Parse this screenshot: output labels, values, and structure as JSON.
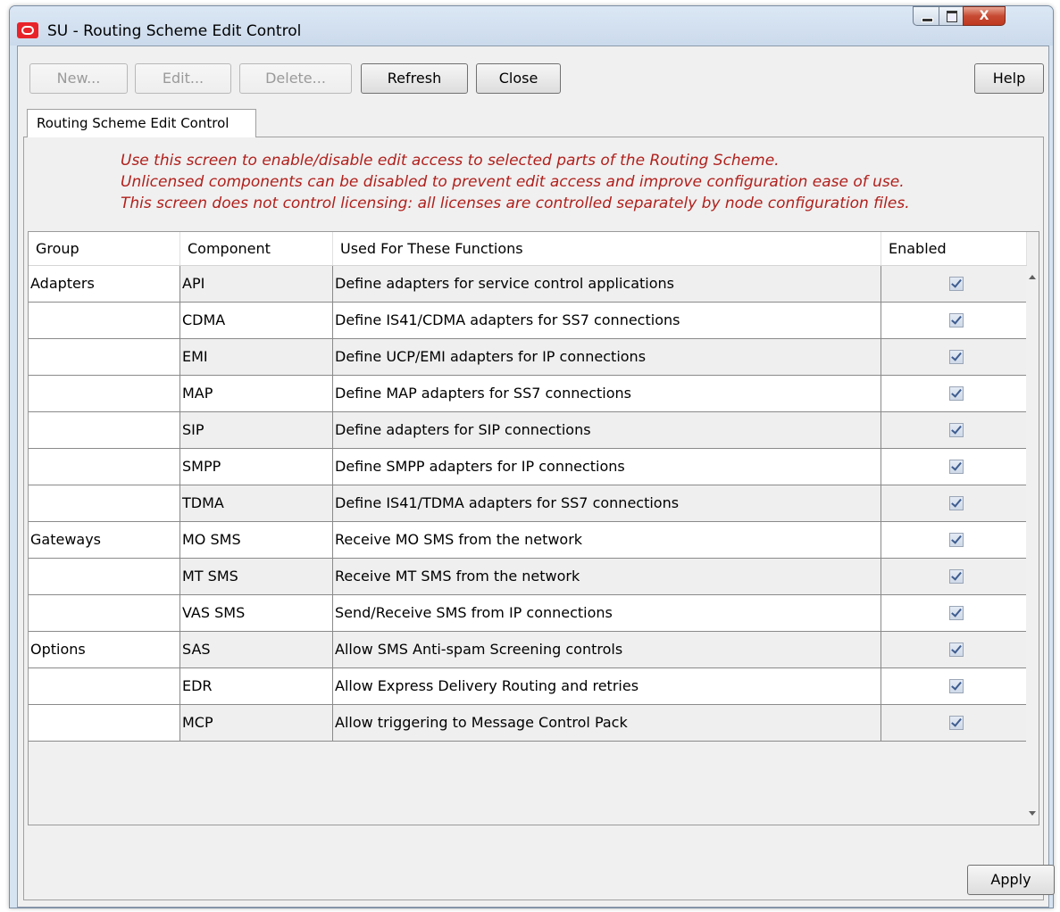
{
  "window": {
    "title": "SU - Routing Scheme Edit Control",
    "close_glyph": "X"
  },
  "toolbar": {
    "new_label": "New...",
    "edit_label": "Edit...",
    "delete_label": "Delete...",
    "refresh_label": "Refresh",
    "close_label": "Close",
    "help_label": "Help"
  },
  "tab": {
    "label": "Routing Scheme Edit Control"
  },
  "info_lines": [
    "Use this screen to enable/disable edit access to selected parts of the Routing Scheme.",
    "Unlicensed components can be disabled to prevent edit access and improve configuration ease of use.",
    "This screen does not control licensing: all licenses are controlled separately by node configuration files."
  ],
  "table": {
    "headers": [
      "Group",
      "Component",
      "Used For These Functions",
      "Enabled"
    ],
    "rows": [
      {
        "group": "Adapters",
        "component": "API",
        "function": "Define adapters for service control applications",
        "enabled": true
      },
      {
        "group": "",
        "component": "CDMA",
        "function": "Define IS41/CDMA adapters for SS7 connections",
        "enabled": true
      },
      {
        "group": "",
        "component": "EMI",
        "function": "Define UCP/EMI adapters for IP connections",
        "enabled": true
      },
      {
        "group": "",
        "component": "MAP",
        "function": "Define MAP adapters for SS7 connections",
        "enabled": true
      },
      {
        "group": "",
        "component": "SIP",
        "function": "Define adapters for SIP connections",
        "enabled": true
      },
      {
        "group": "",
        "component": "SMPP",
        "function": "Define SMPP adapters for IP connections",
        "enabled": true
      },
      {
        "group": "",
        "component": "TDMA",
        "function": "Define IS41/TDMA adapters for SS7 connections",
        "enabled": true
      },
      {
        "group": "Gateways",
        "component": "MO SMS",
        "function": "Receive MO SMS from the network",
        "enabled": true
      },
      {
        "group": "",
        "component": "MT SMS",
        "function": "Receive MT SMS from the network",
        "enabled": true
      },
      {
        "group": "",
        "component": "VAS SMS",
        "function": "Send/Receive SMS from IP connections",
        "enabled": true
      },
      {
        "group": "Options",
        "component": "SAS",
        "function": "Allow SMS Anti-spam Screening controls",
        "enabled": true
      },
      {
        "group": "",
        "component": "EDR",
        "function": "Allow Express Delivery Routing and retries",
        "enabled": true
      },
      {
        "group": "",
        "component": "MCP",
        "function": "Allow triggering to Message Control Pack",
        "enabled": true
      }
    ]
  },
  "footer": {
    "apply_label": "Apply"
  }
}
